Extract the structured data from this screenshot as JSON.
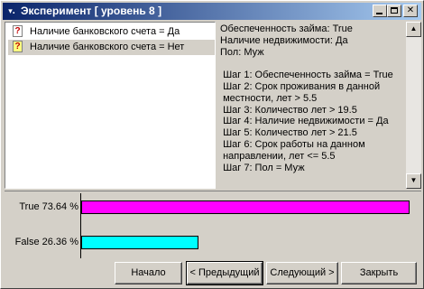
{
  "window": {
    "title": "Эксперимент [ уровень 8 ]",
    "sys_icon": "window-menu-icon",
    "controls": [
      "minimize-icon",
      "maximize-icon",
      "close-icon"
    ]
  },
  "list": {
    "items": [
      {
        "icon": "question-icon",
        "label": "Наличие банковского счета = Да",
        "selected": false
      },
      {
        "icon": "question-icon",
        "label": "Наличие банковского счета = Нет",
        "selected": true
      }
    ]
  },
  "info": {
    "text": "Обеспеченность займа: True\nНаличие недвижимости: Да\nПол: Муж\n\n Шаг 1: Обеспеченность займа = True\n Шаг 2: Срок проживания в данной\n местности, лет > 5.5\n Шаг 3: Количество лет > 19.5\n Шаг 4: Наличие недвижимости = Да\n Шаг 5: Количество лет > 21.5\n Шаг 6: Срок работы на данном\n направлении, лет <= 5.5\n Шаг 7: Пол = Муж"
  },
  "chart_data": {
    "type": "bar",
    "orientation": "horizontal",
    "categories": [
      "True 73.64 %",
      "False 26.36 %"
    ],
    "values": [
      73.64,
      26.36
    ],
    "colors": [
      "#ff00ff",
      "#00ffff"
    ],
    "xlim": [
      0,
      73.64
    ],
    "title": "",
    "xlabel": "",
    "ylabel": ""
  },
  "buttons": {
    "first": "Начало",
    "prev": "< Предыдущий",
    "next": "Следующий >",
    "close": "Закрыть"
  }
}
